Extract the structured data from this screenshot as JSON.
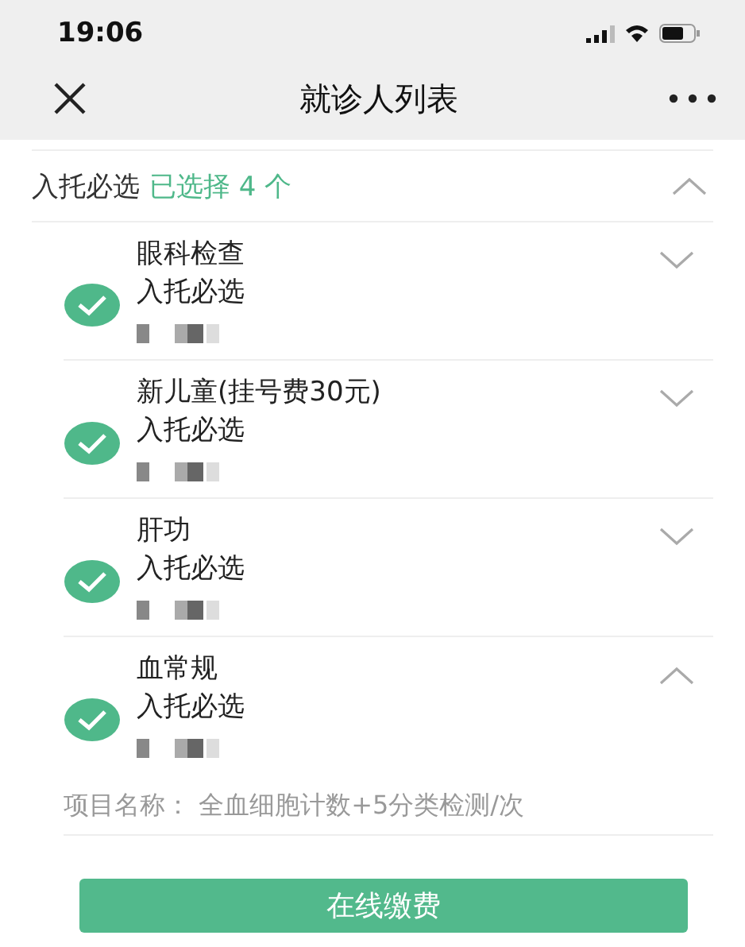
{
  "status_bar": {
    "time": "19:06"
  },
  "nav": {
    "title": "就诊人列表"
  },
  "section": {
    "title": "入托必选",
    "summary": "已选择 4 个",
    "expanded": true
  },
  "items": [
    {
      "name": "眼科检查",
      "tag": "入托必选",
      "checked": true,
      "expanded": false
    },
    {
      "name": "新儿童(挂号费30元)",
      "tag": "入托必选",
      "checked": true,
      "expanded": false
    },
    {
      "name": "肝功",
      "tag": "入托必选",
      "checked": true,
      "expanded": false
    },
    {
      "name": "血常规",
      "tag": "入托必选",
      "checked": true,
      "expanded": true,
      "detail": "项目名称：  全血细胞计数+5分类检测/次"
    }
  ],
  "pay_button": "在线缴费"
}
